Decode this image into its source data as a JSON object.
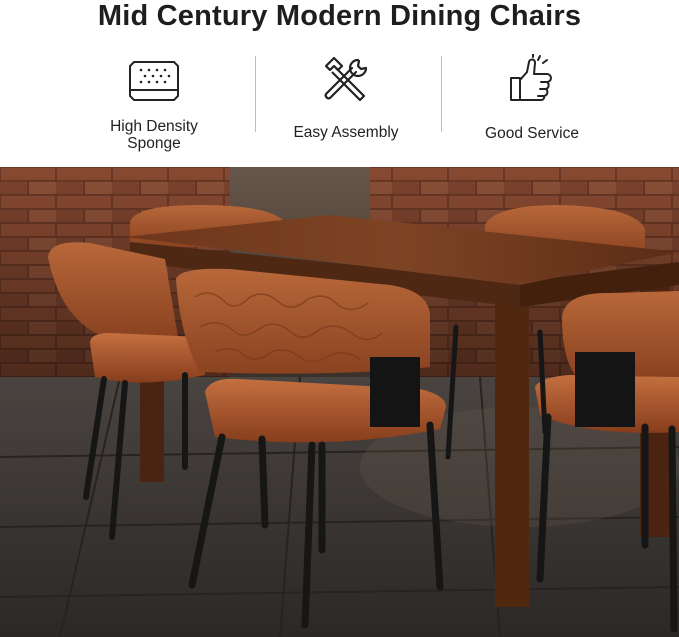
{
  "title": "Mid Century Modern Dining Chairs",
  "features": [
    {
      "icon": "sponge-mattress-icon",
      "label": "High Density\nSponge"
    },
    {
      "icon": "wrench-hammer-icon",
      "label": "Easy Assembly"
    },
    {
      "icon": "thumbs-up-icon",
      "label": "Good Service"
    }
  ],
  "photo": {
    "subject": "dining-set-scene",
    "colors": {
      "brick": "#8a4a32",
      "floor": "#3a3634",
      "table": "#5a2d18",
      "leather": "#a85a2c",
      "legs": "#161616"
    }
  }
}
